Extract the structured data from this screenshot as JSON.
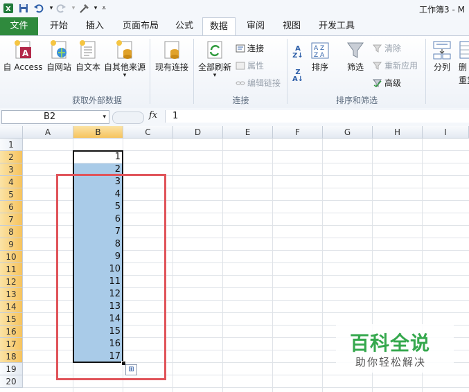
{
  "window": {
    "title": "工作簿3 - M"
  },
  "quick_access": {
    "save_icon": "save-icon",
    "undo_icon": "undo-icon",
    "redo_icon": "redo-icon",
    "tools_icon": "tools-icon",
    "customize_icon": "customize-icon"
  },
  "tabs": {
    "file": "文件",
    "items": [
      "开始",
      "插入",
      "页面布局",
      "公式",
      "数据",
      "审阅",
      "视图",
      "开发工具"
    ],
    "active": "数据"
  },
  "ribbon": {
    "get_external": {
      "label": "获取外部数据",
      "from_access": "自 Access",
      "from_web": "自网站",
      "from_text": "自文本",
      "from_other": "自其他来源",
      "existing": "现有连接"
    },
    "connections": {
      "label": "连接",
      "refresh_all": "全部刷新",
      "connections": "连接",
      "properties": "属性",
      "edit_links": "编辑链接"
    },
    "sort_filter": {
      "label": "排序和筛选",
      "sort": "排序",
      "filter": "筛选",
      "clear": "清除",
      "reapply": "重新应用",
      "advanced": "高级"
    },
    "data_tools": {
      "split": "分列",
      "partial_1": "删",
      "partial_2": "重复"
    }
  },
  "formula_bar": {
    "name_box": "B2",
    "fx": "fx",
    "value": "1"
  },
  "columns": [
    "A",
    "B",
    "C",
    "D",
    "E",
    "F",
    "G",
    "H",
    "I"
  ],
  "selected_column": "B",
  "rows": [
    "1",
    "2",
    "3",
    "4",
    "5",
    "6",
    "7",
    "8",
    "9",
    "10",
    "11",
    "12",
    "13",
    "14",
    "15",
    "16",
    "17",
    "18",
    "19",
    "20"
  ],
  "selected_rows": [
    "2",
    "3",
    "4",
    "5",
    "6",
    "7",
    "8",
    "9",
    "10",
    "11",
    "12",
    "13",
    "14",
    "15",
    "16",
    "17",
    "18"
  ],
  "column_b_values": [
    "1",
    "2",
    "3",
    "4",
    "5",
    "6",
    "7",
    "8",
    "9",
    "10",
    "11",
    "12",
    "13",
    "14",
    "15",
    "16",
    "17"
  ],
  "selection_range": "B2:B18",
  "colors": {
    "selection_fill": "#a9cbe8",
    "header_highlight": "#f6c35e",
    "annotation_box": "#e0545a",
    "file_tab": "#2f8a3d",
    "watermark_green": "#35a84d"
  },
  "watermark": {
    "title": "百科全说",
    "subtitle": "助你轻松解决"
  }
}
